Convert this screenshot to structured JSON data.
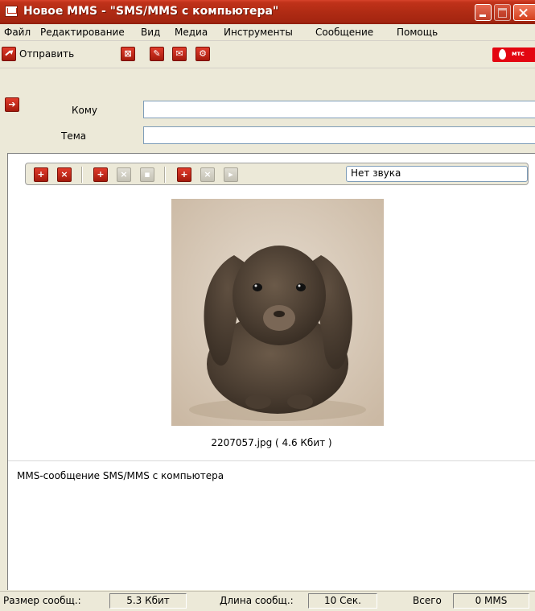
{
  "window": {
    "title": "Новое MMS - \"SMS/MMS с компьютера\""
  },
  "menu": {
    "items": [
      {
        "label": "Файл"
      },
      {
        "label": "Редактирование"
      },
      {
        "label": "Вид"
      },
      {
        "label": "Медиа"
      },
      {
        "label": "Инструменты"
      },
      {
        "label": "Сообщение"
      },
      {
        "label": "Помощь"
      }
    ]
  },
  "toolbar": {
    "send_label": "Отправить",
    "icons": [
      "save-draft-icon",
      "address-book-icon",
      "envelope-icon",
      "settings-icon"
    ],
    "brand_label": "мтс",
    "brand_color": "#e30611"
  },
  "address": {
    "to_label": "Кому",
    "to_value": "",
    "subject_label": "Тема",
    "subject_value": ""
  },
  "media_toolbar": {
    "icons": [
      "add-slide-icon",
      "delete-slide-icon",
      "add-image-icon",
      "remove-image-icon",
      "image-properties-icon",
      "add-sound-icon",
      "remove-sound-icon",
      "sound-properties-icon"
    ],
    "sound_value": "Нет звука"
  },
  "slide": {
    "image_caption": "2207057.jpg ( 4.6 Кбит )",
    "text": "MMS-сообщение SMS/MMS с компьютера"
  },
  "status": {
    "size_label": "Размер сообщ.:",
    "size_value": "5.3 Кбит",
    "length_label": "Длина сообщ.:",
    "length_value": "10 Сек.",
    "total_label": "Всего",
    "total_value": "0 MMS"
  },
  "colors": {
    "accent": "#c0321a",
    "titlebar": "#b02b14"
  }
}
